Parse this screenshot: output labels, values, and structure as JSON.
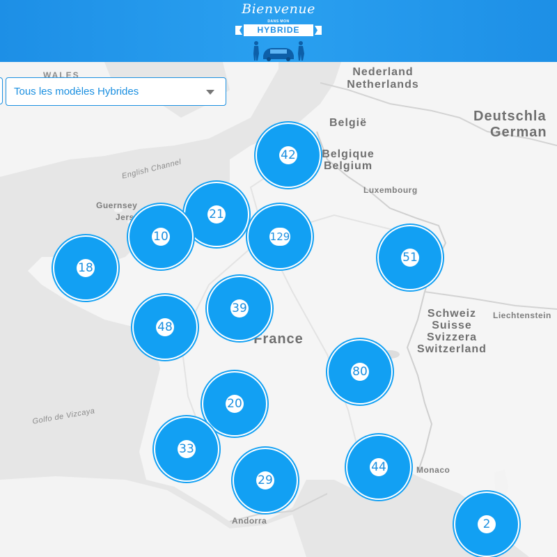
{
  "header": {
    "logo": {
      "script": "Bienvenue",
      "small": "DANS MON",
      "banner": "HYBRIDE"
    }
  },
  "filter": {
    "selected": "Tous les modèles Hybrides"
  },
  "map": {
    "labels": {
      "wales": "WALES",
      "nederland": "Nederland",
      "netherlands": "Netherlands",
      "deutschland": "Deutschla",
      "germany": "German",
      "belgie": "België",
      "belgique": "Belgique",
      "belgium": "Belgium",
      "english_channel": "English Channel",
      "guernsey": "Guernsey",
      "jersey": "Jers",
      "luxembourg": "Luxembourg",
      "schweiz": "Schweiz",
      "suisse": "Suisse",
      "svizzera": "Svizzera",
      "switzerland": "Switzerland",
      "liechtenstein": "Liechtenstein",
      "france": "France",
      "golfo": "Golfo de Vizcaya",
      "monaco": "Monaco",
      "andorra": "Andorra"
    },
    "clusters": {
      "c42": "42",
      "c21": "21",
      "c10": "10",
      "c129": "129",
      "c51": "51",
      "c18": "18",
      "c39": "39",
      "c48": "48",
      "c80": "80",
      "c20": "20",
      "c33": "33",
      "c44": "44",
      "c29": "29",
      "c2": "2"
    },
    "colors": {
      "cluster": "#12a0f3",
      "header": "#1d8fe6",
      "accent": "#1a8fe0"
    }
  }
}
